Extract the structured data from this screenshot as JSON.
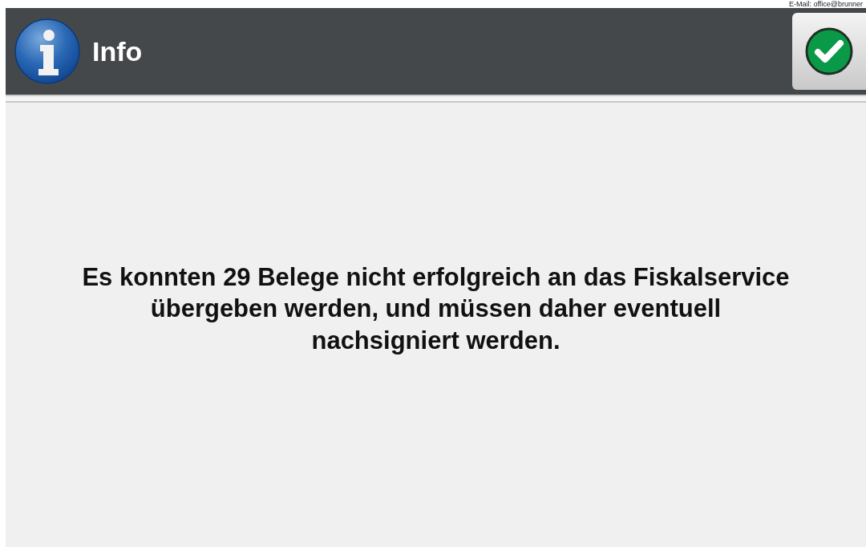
{
  "top_note": "E-Mail: office@brunner",
  "header": {
    "title": "Info"
  },
  "message": "Es konnten 29 Belege nicht erfolgreich an das Fiskalservice übergeben werden, und müssen daher eventuell nachsigniert werden."
}
